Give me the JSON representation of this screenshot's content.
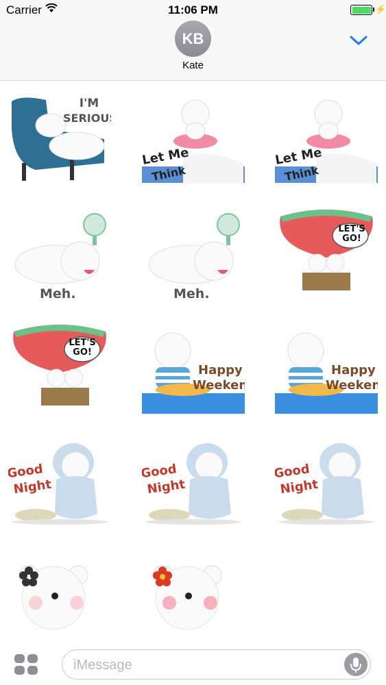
{
  "status_bar": {
    "carrier": "Carrier",
    "time": "11:06 PM",
    "battery_level": 1.0,
    "battery_color": "#4cd964",
    "icons": [
      "wifi-icon",
      "battery-icon",
      "charging-bolt-icon"
    ]
  },
  "header": {
    "avatar_initials": "KB",
    "contact_name": "Kate",
    "accent_color": "#1a7cf5",
    "collapse_icon": "chevron-down-icon"
  },
  "stickers": [
    {
      "caption_1": "I'M",
      "caption_2": "SERIOUS"
    },
    {
      "caption_1": "Let Me",
      "caption_2": "Think"
    },
    {
      "caption_1": "Let Me",
      "caption_2": "Think"
    },
    {
      "caption_1": "Meh."
    },
    {
      "caption_1": "Meh."
    },
    {
      "caption_1": "LET'S",
      "caption_2": "GO!"
    },
    {
      "caption_1": "LET'S",
      "caption_2": "GO!"
    },
    {
      "caption_1": "Happy",
      "caption_2": "Weekend"
    },
    {
      "caption_1": "Happy",
      "caption_2": "Weekend"
    },
    {
      "caption_1": "Good",
      "caption_2": "Night"
    },
    {
      "caption_1": "Good",
      "caption_2": "Night"
    },
    {
      "caption_1": "Good",
      "caption_2": "Night"
    },
    {},
    {}
  ],
  "input_bar": {
    "placeholder": "iMessage",
    "apps_icon": "app-drawer-icon",
    "mic_icon": "microphone-icon"
  }
}
